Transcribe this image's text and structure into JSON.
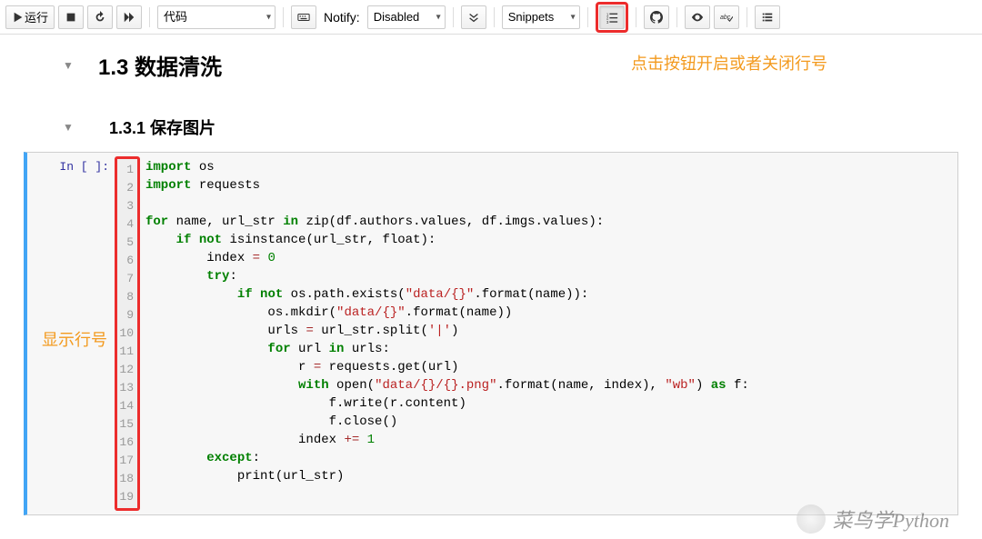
{
  "toolbar": {
    "run": "运行",
    "cell_type": "代码",
    "notify_label": "Notify:",
    "notify_value": "Disabled",
    "snippets": "Snippets"
  },
  "annotations": {
    "top": "点击按钮开启或者关闭行号",
    "left": "显示行号"
  },
  "headings": {
    "h1": "1.3  数据清洗",
    "h2": "1.3.1  保存图片"
  },
  "cell": {
    "prompt": "In [ ]:",
    "line_numbers": [
      "1",
      "2",
      "3",
      "4",
      "5",
      "6",
      "7",
      "8",
      "9",
      "10",
      "11",
      "12",
      "13",
      "14",
      "15",
      "16",
      "17",
      "18",
      "19"
    ],
    "code_tokens": [
      [
        [
          "kw",
          "import"
        ],
        [
          "nm",
          " os"
        ]
      ],
      [
        [
          "kw",
          "import"
        ],
        [
          "nm",
          " requests"
        ]
      ],
      [],
      [
        [
          "kw",
          "for"
        ],
        [
          "nm",
          " name, url_str "
        ],
        [
          "kw",
          "in"
        ],
        [
          "nm",
          " zip(df.authors.values, df.imgs.values):"
        ]
      ],
      [
        [
          "nm",
          "    "
        ],
        [
          "kw",
          "if"
        ],
        [
          "nm",
          " "
        ],
        [
          "kw",
          "not"
        ],
        [
          "nm",
          " isinstance(url_str, float):"
        ]
      ],
      [
        [
          "nm",
          "        index "
        ],
        [
          "op",
          "="
        ],
        [
          "nm",
          " "
        ],
        [
          "num",
          "0"
        ]
      ],
      [
        [
          "nm",
          "        "
        ],
        [
          "kw",
          "try"
        ],
        [
          "nm",
          ":"
        ]
      ],
      [
        [
          "nm",
          "            "
        ],
        [
          "kw",
          "if"
        ],
        [
          "nm",
          " "
        ],
        [
          "kw",
          "not"
        ],
        [
          "nm",
          " os.path.exists("
        ],
        [
          "str",
          "\"data/{}\""
        ],
        [
          "nm",
          ".format(name)):"
        ]
      ],
      [
        [
          "nm",
          "                os.mkdir("
        ],
        [
          "str",
          "\"data/{}\""
        ],
        [
          "nm",
          ".format(name))"
        ]
      ],
      [
        [
          "nm",
          "                urls "
        ],
        [
          "op",
          "="
        ],
        [
          "nm",
          " url_str.split("
        ],
        [
          "str",
          "'|'"
        ],
        [
          "nm",
          ")"
        ]
      ],
      [
        [
          "nm",
          "                "
        ],
        [
          "kw",
          "for"
        ],
        [
          "nm",
          " url "
        ],
        [
          "kw",
          "in"
        ],
        [
          "nm",
          " urls:"
        ]
      ],
      [
        [
          "nm",
          "                    r "
        ],
        [
          "op",
          "="
        ],
        [
          "nm",
          " requests.get(url)"
        ]
      ],
      [
        [
          "nm",
          "                    "
        ],
        [
          "kw",
          "with"
        ],
        [
          "nm",
          " open("
        ],
        [
          "str",
          "\"data/{}/{}.png\""
        ],
        [
          "nm",
          ".format(name, index), "
        ],
        [
          "str",
          "\"wb\""
        ],
        [
          "nm",
          ") "
        ],
        [
          "kw",
          "as"
        ],
        [
          "nm",
          " f:"
        ]
      ],
      [
        [
          "nm",
          "                        f.write(r.content)"
        ]
      ],
      [
        [
          "nm",
          "                        f.close()"
        ]
      ],
      [
        [
          "nm",
          "                    index "
        ],
        [
          "op",
          "+="
        ],
        [
          "nm",
          " "
        ],
        [
          "num",
          "1"
        ]
      ],
      [
        [
          "nm",
          "        "
        ],
        [
          "kw",
          "except"
        ],
        [
          "nm",
          ":"
        ]
      ],
      [
        [
          "nm",
          "            print(url_str)"
        ]
      ],
      []
    ]
  },
  "watermark": "菜鸟学Python"
}
